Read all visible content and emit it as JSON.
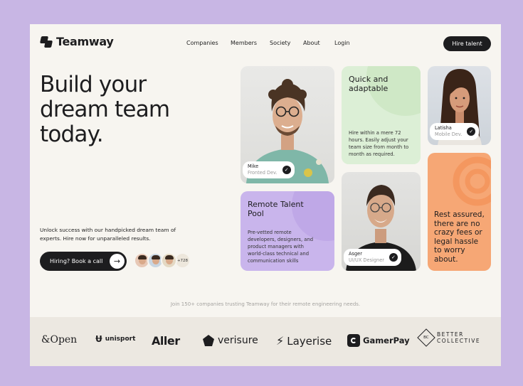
{
  "header": {
    "brand": "Teamway",
    "nav": [
      "Companies",
      "Members",
      "Society",
      "About",
      "Login"
    ],
    "cta": "Hire talent"
  },
  "hero": {
    "title_lines": [
      "Build your",
      "dream team",
      "today."
    ],
    "subtitle": "Unlock success with our handpicked dream team of experts. Hire now for unparalleled results.",
    "cta": "Hiring? Book a call",
    "avatar_count": "+728"
  },
  "cards": {
    "mike": {
      "name": "Mike",
      "role": "Fronted Dev."
    },
    "quick": {
      "title": "Quick and adaptable",
      "body": "Hire within a mere 72 hours. Easily adjust your team size from month to month as required."
    },
    "latisha": {
      "name": "Latisha",
      "role": "Mobile Dev."
    },
    "remote": {
      "title": "Remote Talent Pool",
      "body": "Pre-vetted remote developers, designers, and product managers with world-class technical and communication skills"
    },
    "asger": {
      "name": "Asger",
      "role": "UI/UX Designer"
    },
    "rest": {
      "title": "Rest assured, there are no crazy fees or legal hassle to worry about."
    }
  },
  "trust": {
    "text": "Join 150+ companies trusting Teamway for their remote engineering needs.",
    "logos": [
      "&Open",
      "unisport",
      "Aller",
      "verisure",
      "Layerise",
      "GamerPay",
      "BETTER",
      "COLLECTIVE",
      "BC"
    ]
  },
  "colors": {
    "background": "#c8b6e4",
    "page": "#f7f5f0",
    "dark": "#1d1d1f",
    "green_card": "#dcefd6",
    "purple_card": "#c9b5ec",
    "orange_card": "#f6a775"
  }
}
